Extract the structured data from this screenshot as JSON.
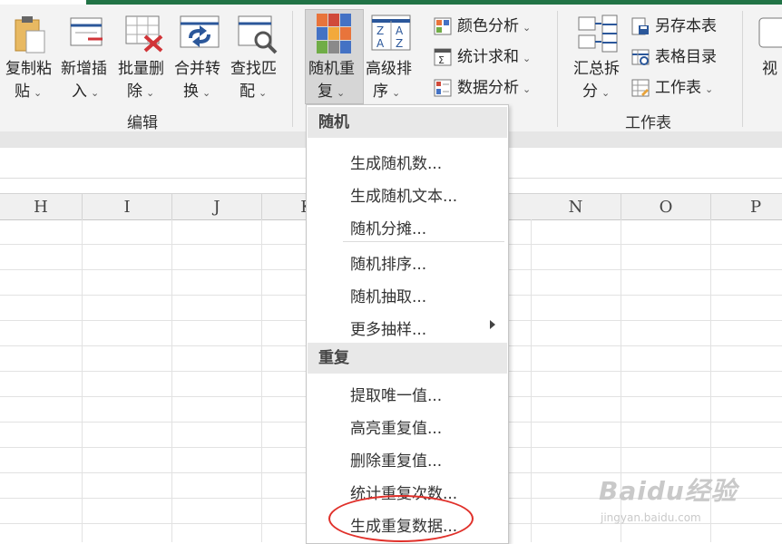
{
  "ribbon": {
    "buttons": [
      {
        "l1": "复制粘",
        "l2": "贴",
        "icon": "paste-icon"
      },
      {
        "l1": "新增插",
        "l2": "入",
        "icon": "insert-icon"
      },
      {
        "l1": "批量删",
        "l2": "除",
        "icon": "delete-icon"
      },
      {
        "l1": "合并转",
        "l2": "换",
        "icon": "merge-convert-icon"
      },
      {
        "l1": "查找匹",
        "l2": "配",
        "icon": "find-match-icon"
      },
      {
        "l1": "随机重",
        "l2": "复",
        "icon": "random-repeat-icon"
      },
      {
        "l1": "高级排",
        "l2": "序",
        "icon": "sort-az-icon"
      },
      {
        "l1": "汇总拆",
        "l2": "分",
        "icon": "summary-split-icon"
      },
      {
        "l1": "视",
        "l2": "",
        "icon": "view-icon"
      }
    ],
    "small_buttons": [
      {
        "label": "颜色分析",
        "icon": "color-analysis-icon"
      },
      {
        "label": "统计求和",
        "icon": "statistics-sum-icon"
      },
      {
        "label": "数据分析",
        "icon": "data-analysis-icon"
      },
      {
        "label": "另存本表",
        "icon": "save-sheet-icon"
      },
      {
        "label": "表格目录",
        "icon": "table-directory-icon"
      },
      {
        "label": "工作表",
        "icon": "worksheet-icon"
      }
    ],
    "groups": {
      "edit": "编辑",
      "worksheet": "工作表"
    },
    "accent_color": "#217346"
  },
  "columns": [
    "H",
    "I",
    "J",
    "K",
    "N",
    "O",
    "P"
  ],
  "menu": {
    "sections": [
      {
        "title": "随机",
        "items": [
          "生成随机数...",
          "生成随机文本...",
          "随机分摊...",
          "随机排序...",
          "随机抽取...",
          "更多抽样..."
        ]
      },
      {
        "title": "重复",
        "items": [
          "提取唯一值...",
          "高亮重复值...",
          "删除重复值...",
          "统计重复次数...",
          "生成重复数据..."
        ]
      }
    ],
    "highlight_color": "#e0302a"
  },
  "watermark": {
    "brand": "Baidu经验",
    "url": "jingyan.baidu.com"
  }
}
